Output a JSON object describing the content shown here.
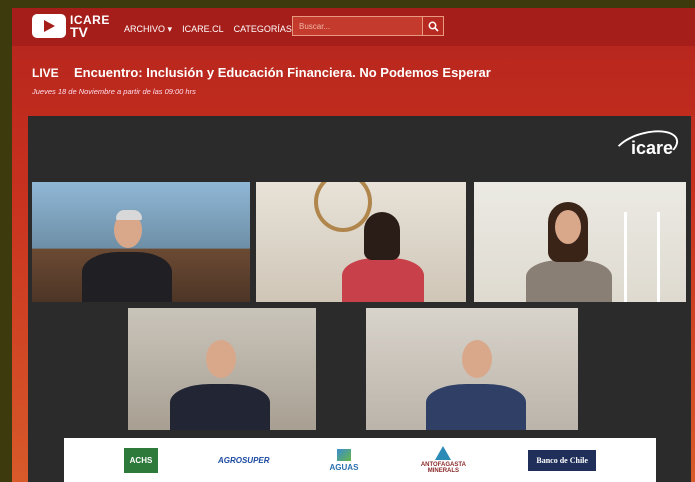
{
  "header": {
    "logo_line1": "ICARE",
    "logo_line2": "TV",
    "nav": [
      {
        "label": "ARCHIVO",
        "dropdown": true
      },
      {
        "label": "ICARE.CL",
        "dropdown": false
      },
      {
        "label": "CATEGORÍAS",
        "dropdown": true
      }
    ],
    "search_placeholder": "Buscar..."
  },
  "event": {
    "live_label": "LIVE",
    "title": "Encuentro: Inclusión y Educación Financiera. No Podemos Esperar",
    "subtitle": "Jueves 18 de Noviembre a partir de las 09:00 hrs"
  },
  "video": {
    "brand": "icare"
  },
  "sponsors": [
    "ACHS",
    "AGROSUPER",
    "AGUAS",
    "ANTOFAGASTA MINERALS",
    "Banco de Chile"
  ],
  "colors": {
    "header": "#a61e1a",
    "background_red": "#c8321f",
    "video_bg": "#2b2b2b"
  }
}
